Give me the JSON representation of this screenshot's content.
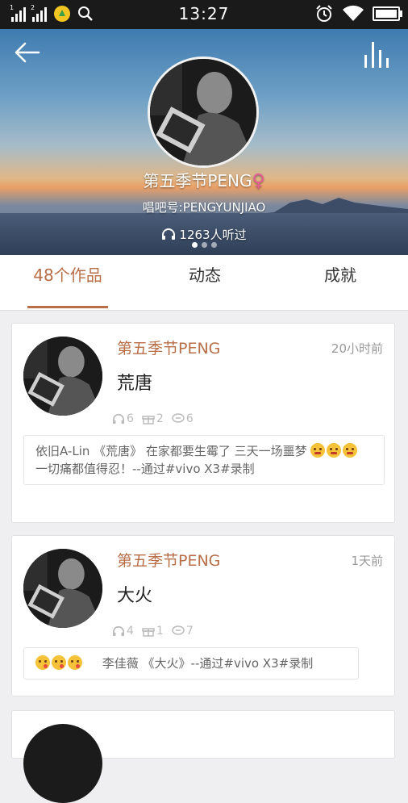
{
  "status_bar": {
    "time": "13:27",
    "sim1": "1",
    "sim2": "2"
  },
  "profile": {
    "name": "第五季节PENG",
    "gender_symbol": "♀",
    "changba_id": "唱吧号:PENGYUNJIAO",
    "listen_count": "1263人听过"
  },
  "tabs": [
    {
      "label": "48个作品",
      "active": true
    },
    {
      "label": "动态",
      "active": false
    },
    {
      "label": "成就",
      "active": false
    }
  ],
  "works": [
    {
      "author": "第五季节PENG",
      "time": "20小时前",
      "title": "荒唐",
      "listens": "6",
      "gifts": "2",
      "comments": "6",
      "desc_before": "依旧A-Lin 《荒唐》 在家都要生霉了 三天一场噩梦",
      "desc_after": "一切痛都值得忍！--通过#vivo X3#录制",
      "emojis": 3
    },
    {
      "author": "第五季节PENG",
      "time": "1天前",
      "title": "大火",
      "listens": "4",
      "gifts": "1",
      "comments": "7",
      "desc_before": "",
      "desc_after": "李佳薇 《大火》--通过#vivo X3#录制",
      "emojis": 3
    }
  ],
  "colors": {
    "accent": "#b86e47",
    "gender": "#e75d98",
    "statusbar": "#1a1a1a"
  }
}
